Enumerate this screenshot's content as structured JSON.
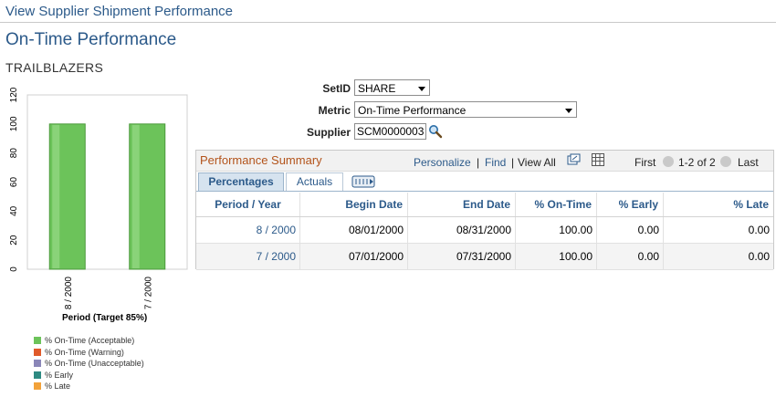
{
  "breadcrumb": "View Supplier Shipment Performance",
  "page_title": "On-Time Performance",
  "company": "TRAILBLAZERS",
  "form": {
    "setid_label": "SetID",
    "setid_value": "SHARE",
    "metric_label": "Metric",
    "metric_value": "On-Time Performance",
    "supplier_label": "Supplier",
    "supplier_value": "SCM0000003"
  },
  "grid": {
    "title": "Performance Summary",
    "personalize": "Personalize",
    "find": "Find",
    "separator": "|",
    "view_all": "View All",
    "first": "First",
    "range": "1-2 of 2",
    "last": "Last",
    "tabs": [
      "Percentages",
      "Actuals"
    ],
    "columns": [
      "Period / Year",
      "Begin Date",
      "End Date",
      "% On-Time",
      "% Early",
      "% Late"
    ],
    "rows": [
      {
        "period": "8 / 2000",
        "begin": "08/01/2000",
        "end": "08/31/2000",
        "ontime": "100.00",
        "early": "0.00",
        "late": "0.00"
      },
      {
        "period": "7 / 2000",
        "begin": "07/01/2000",
        "end": "07/31/2000",
        "ontime": "100.00",
        "early": "0.00",
        "late": "0.00"
      }
    ]
  },
  "chart_data": {
    "type": "bar",
    "categories": [
      "8 / 2000",
      "7 / 2000"
    ],
    "series": [
      {
        "name": "% On-Time (Acceptable)",
        "values": [
          100,
          100
        ],
        "color": "#6cc35a"
      }
    ],
    "xlabel": "Period (Target 85%)",
    "ylabel": "",
    "ylim": [
      0,
      120
    ],
    "yticks": [
      0,
      20,
      40,
      60,
      80,
      100,
      120
    ],
    "legend": [
      {
        "label": "% On-Time (Acceptable)",
        "color": "#6cc35a"
      },
      {
        "label": "% On-Time (Warning)",
        "color": "#e05a2a"
      },
      {
        "label": "% On-Time (Unacceptable)",
        "color": "#8a86b8"
      },
      {
        "label": "% Early",
        "color": "#2e8a82"
      },
      {
        "label": "% Late",
        "color": "#f2a23a"
      }
    ]
  }
}
